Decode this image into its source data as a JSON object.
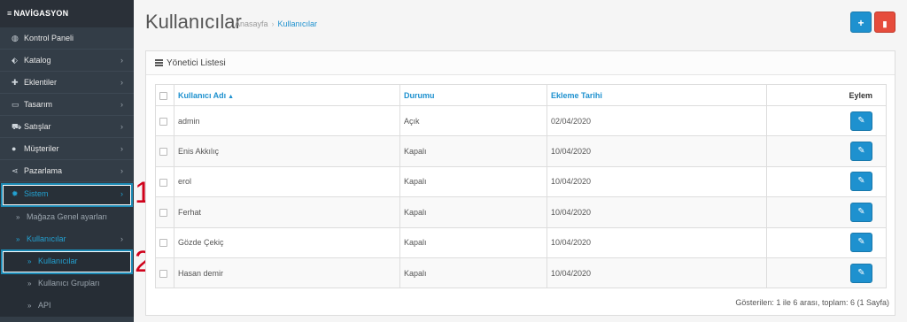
{
  "nav": {
    "header": "NAVİGASYON",
    "items": [
      {
        "label": "Kontrol Paneli",
        "icon": "dashboard-icon",
        "glyph": "◍",
        "chevron": ""
      },
      {
        "label": "Katalog",
        "icon": "tags-icon",
        "glyph": "⬖",
        "chevron": "›"
      },
      {
        "label": "Eklentiler",
        "icon": "puzzle-icon",
        "glyph": "✚",
        "chevron": "›"
      },
      {
        "label": "Tasarım",
        "icon": "monitor-icon",
        "glyph": "▭",
        "chevron": "›"
      },
      {
        "label": "Satışlar",
        "icon": "cart-icon",
        "glyph": "⛟",
        "chevron": "›"
      },
      {
        "label": "Müşteriler",
        "icon": "user-icon",
        "glyph": "●",
        "chevron": "›"
      },
      {
        "label": "Pazarlama",
        "icon": "share-icon",
        "glyph": "⋖",
        "chevron": "›"
      },
      {
        "label": "Sistem",
        "icon": "gear-icon",
        "glyph": "✹",
        "chevron": "›"
      }
    ],
    "sub": [
      {
        "label": "Mağaza Genel ayarları"
      },
      {
        "label": "Kullanıcılar",
        "chevron": "›"
      },
      {
        "label": "Kullanıcılar"
      },
      {
        "label": "Kullanıcı Grupları"
      },
      {
        "label": "API"
      }
    ]
  },
  "annotations": {
    "one": "1",
    "two": "2"
  },
  "page": {
    "title": "Kullanıcılar",
    "breadcrumb": [
      "Anasayfa",
      "Kullanıcılar"
    ],
    "add_glyph": "+",
    "delete_glyph": "🗑"
  },
  "panel": {
    "title": "Yönetici Listesi",
    "columns": {
      "username": "Kullanıcı Adı",
      "sort_glyph": "▲",
      "status": "Durumu",
      "date": "Ekleme Tarihi",
      "action": "Eylem"
    },
    "rows": [
      {
        "username": "admin",
        "status": "Açık",
        "date": "02/04/2020"
      },
      {
        "username": "Enis Akkılıç",
        "status": "Kapalı",
        "date": "10/04/2020"
      },
      {
        "username": "erol",
        "status": "Kapalı",
        "date": "10/04/2020"
      },
      {
        "username": "Ferhat",
        "status": "Kapalı",
        "date": "10/04/2020"
      },
      {
        "username": "Gözde Çekiç",
        "status": "Kapalı",
        "date": "10/04/2020"
      },
      {
        "username": "Hasan demir",
        "status": "Kapalı",
        "date": "10/04/2020"
      }
    ],
    "edit_glyph": "✎",
    "pagination": "Gösterilen: 1 ile 6 arası, toplam: 6 (1 Sayfa)"
  },
  "colors": {
    "sidebar": "#333d47",
    "accent": "#1e91cf",
    "danger": "#e64c3c",
    "annotation": "#d0021b"
  }
}
